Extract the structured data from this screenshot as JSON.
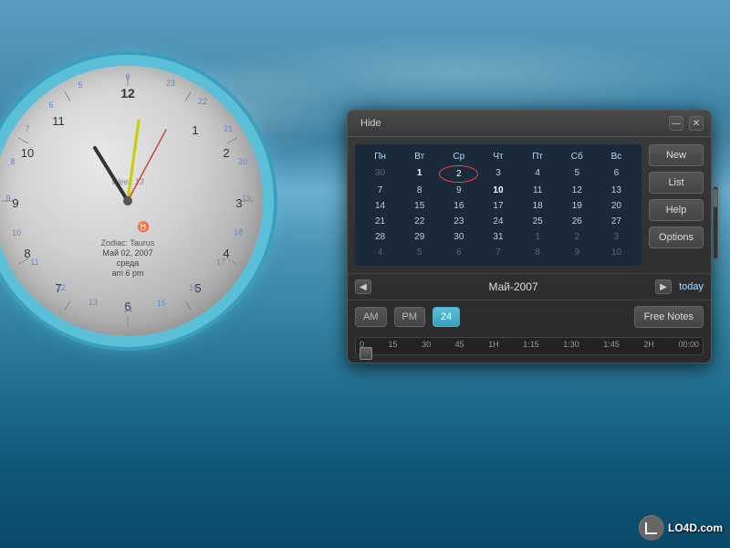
{
  "background": {
    "type": "ocean"
  },
  "clock": {
    "zodiac": "Zodiac: Taurus",
    "date": "Май 02, 2007",
    "day": "среда",
    "ampm": "am 6 pm",
    "week": "Week 13",
    "numbers_inner": [
      "12",
      "1",
      "2",
      "3",
      "4",
      "5",
      "6",
      "7",
      "8",
      "9",
      "10",
      "11"
    ],
    "numbers_outer": [
      "0",
      "23",
      "22",
      "21",
      "20",
      "19",
      "18",
      "17",
      "16",
      "15",
      "14",
      "13"
    ]
  },
  "panel": {
    "hide_label": "Hide",
    "minimize_symbol": "—",
    "close_symbol": "✕",
    "calendar": {
      "headers": [
        "Пн",
        "Вт",
        "Ср",
        "Чт",
        "Пт",
        "Сб",
        "Вс"
      ],
      "month_label": "Май-2007",
      "today_label": "today",
      "rows": [
        [
          "30",
          "1",
          "2",
          "3",
          "4",
          "5",
          "6"
        ],
        [
          "7",
          "8",
          "9",
          "10",
          "11",
          "12",
          "13"
        ],
        [
          "14",
          "15",
          "16",
          "17",
          "18",
          "19",
          "20"
        ],
        [
          "21",
          "22",
          "23",
          "24",
          "25",
          "26",
          "27"
        ],
        [
          "28",
          "29",
          "30",
          "31",
          "1",
          "2",
          "3"
        ],
        [
          "4",
          "5",
          "6",
          "7",
          "8",
          "9",
          "10"
        ]
      ],
      "muted_cells": [
        "30",
        "1",
        "2",
        "3"
      ],
      "selected_day": "2",
      "bold_days": [
        "1",
        "10"
      ]
    },
    "buttons": {
      "new_label": "New",
      "list_label": "List",
      "help_label": "Help",
      "options_label": "Options"
    },
    "time_buttons": {
      "am_label": "AM",
      "pm_label": "PM",
      "hour24_label": "24"
    },
    "free_notes_label": "Free Notes",
    "timeline": {
      "labels": [
        "0",
        "15",
        "30",
        "45",
        "1H",
        "1:15",
        "1:30",
        "1:45",
        "2H",
        "00:00"
      ]
    }
  },
  "watermark": {
    "text": "LO4D.com"
  }
}
